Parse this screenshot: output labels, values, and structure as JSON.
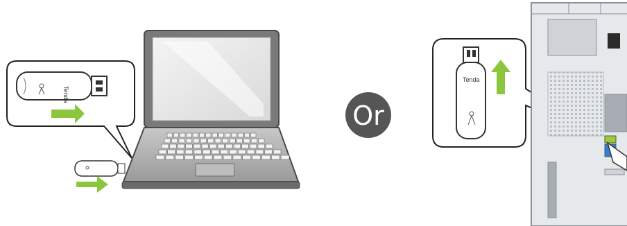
{
  "or_label": "Or",
  "brand_text": "Tenda",
  "colors": {
    "arrow_green": "#8cc63f",
    "arrow_green_light": "#c6e29a",
    "or_circle": "#555555",
    "tower_body": "#e6e9ec",
    "usb_port_blue": "#2f7fd6",
    "usb_port_green": "#9acd32"
  },
  "icons": [
    "laptop-icon",
    "usb-adapter-icon",
    "insert-right-arrow-icon",
    "insert-up-arrow-icon",
    "desktop-tower-icon"
  ]
}
